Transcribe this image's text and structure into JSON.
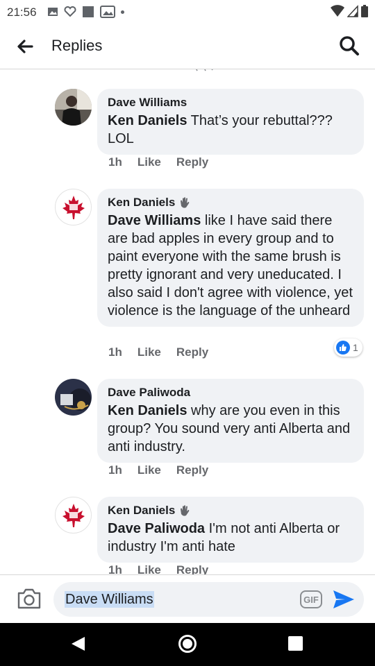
{
  "status_bar": {
    "time": "21:56"
  },
  "header": {
    "title": "Replies"
  },
  "comments": [
    {
      "author": "Dave Williams",
      "mention": "Ken Daniels",
      "text": " That’s your rebuttal??? LOL",
      "time": "1h",
      "like": "Like",
      "reply": "Reply"
    },
    {
      "author": "Ken Daniels",
      "mention": "Dave Williams",
      "text": " like I have said there are bad apples in every group and to paint everyone with the same brush is pretty ignorant and very uneducated. I also said I don't agree with violence, yet violence is the language of the unheard",
      "time": "1h",
      "like": "Like",
      "reply": "Reply",
      "reaction_count": "1"
    },
    {
      "author": "Dave Paliwoda",
      "mention": "Ken Daniels",
      "text": " why are you even in this group? You sound very anti Alberta and anti industry.",
      "time": "1h",
      "like": "Like",
      "reply": "Reply"
    },
    {
      "author": "Ken Daniels",
      "mention": "Dave Paliwoda",
      "text": " I'm not anti Alberta or industry I'm anti hate",
      "time": "1h",
      "like": "Like",
      "reply": "Reply"
    }
  ],
  "composer": {
    "value": "Dave Williams",
    "gif_label": "GIF"
  },
  "colors": {
    "accent": "#1877f2",
    "bubble": "#f0f2f5",
    "meta": "#65676b",
    "leaf_red": "#c8102e"
  },
  "icons": [
    "back-arrow-icon",
    "search-icon",
    "camera-icon",
    "send-icon",
    "wave-hand-icon",
    "like-reaction-icon",
    "maple-leaf-icon"
  ]
}
